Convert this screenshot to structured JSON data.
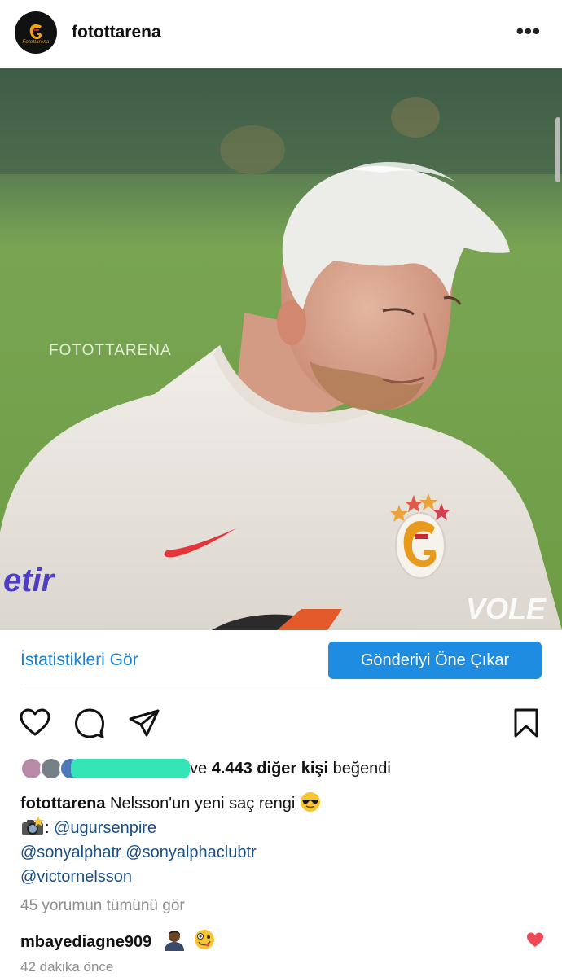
{
  "header": {
    "username": "fotottarena",
    "avatar_text": "Fotottarena",
    "more_label": "•••"
  },
  "photo": {
    "watermark_left": "FOTOTTARENA",
    "watermark_right": "VOLE",
    "sponsor_text": "etir"
  },
  "cta": {
    "stats_label": "İstatistikleri Gör",
    "promote_label": "Gönderiyi Öne Çıkar"
  },
  "actions": {
    "icons": [
      "heart-icon",
      "comment-icon",
      "share-icon",
      "bookmark-icon"
    ]
  },
  "likes": {
    "prefix": "ve ",
    "count": "4.443 diğer kişi",
    "suffix": " beğendi",
    "redaction_color": "#35e5b5"
  },
  "caption": {
    "username": "fotottarena",
    "text": " Nelsson'un yeni saç rengi ",
    "emoji": "sunglasses-emoji",
    "credit_prefix": ": ",
    "credit_emoji": "camera-flash-emoji",
    "mention_1": "@ugursenpire",
    "mention_2": "@sonyalphatr",
    "mention_3": "@sonyalphaclubtr",
    "mention_4": "@victornelsson"
  },
  "comments": {
    "view_all": "45 yorumun tümünü gör",
    "top_comment_user": "mbayediagne909",
    "top_comment_emojis": [
      "person-emoji",
      "zany-face-emoji"
    ]
  },
  "timestamp": "42 dakika önce",
  "colors": {
    "link_blue": "#1a82d6",
    "button_blue": "#1e8ce0",
    "mention_blue": "#1a4f86",
    "muted": "#8e8e8e",
    "like_red": "#ed4956"
  }
}
